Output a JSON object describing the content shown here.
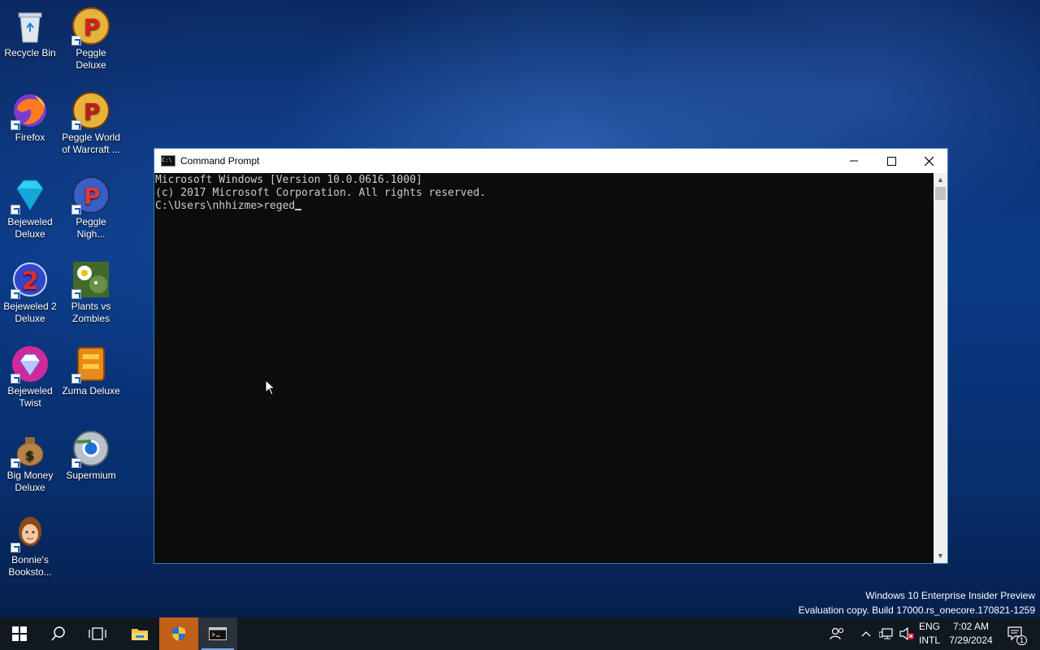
{
  "desktop": {
    "icons": [
      {
        "label": "Recycle Bin"
      },
      {
        "label": "Peggle Deluxe"
      },
      {
        "label": "Firefox"
      },
      {
        "label": "Peggle World of Warcraft ..."
      },
      {
        "label": "Bejeweled Deluxe"
      },
      {
        "label": "Peggle Nigh..."
      },
      {
        "label": "Bejeweled 2 Deluxe"
      },
      {
        "label": "Plants vs Zombies"
      },
      {
        "label": "Bejeweled Twist"
      },
      {
        "label": "Zuma Deluxe"
      },
      {
        "label": "Big Money Deluxe"
      },
      {
        "label": "Supermium"
      },
      {
        "label": "Bonnie's Booksto..."
      }
    ]
  },
  "window": {
    "title": "Command Prompt",
    "icon_text": "C:\\",
    "lines": [
      "Microsoft Windows [Version 10.0.0616.1000]",
      "(c) 2017 Microsoft Corporation. All rights reserved."
    ],
    "prompt": "C:\\Users\\nhhizme>",
    "typed": "reged"
  },
  "watermark": {
    "line1": "Windows 10 Enterprise Insider Preview",
    "line2": "Evaluation copy. Build 17000.rs_onecore.170821-1259"
  },
  "tray": {
    "lang_top": "ENG",
    "lang_bottom": "INTL",
    "time": "7:02 AM",
    "date": "7/29/2024",
    "notification_count": "1"
  },
  "colors": {
    "taskbar": "#101820",
    "active_app": "#c2601a",
    "console_bg": "#0c0c0c",
    "console_fg": "#cccccc"
  }
}
